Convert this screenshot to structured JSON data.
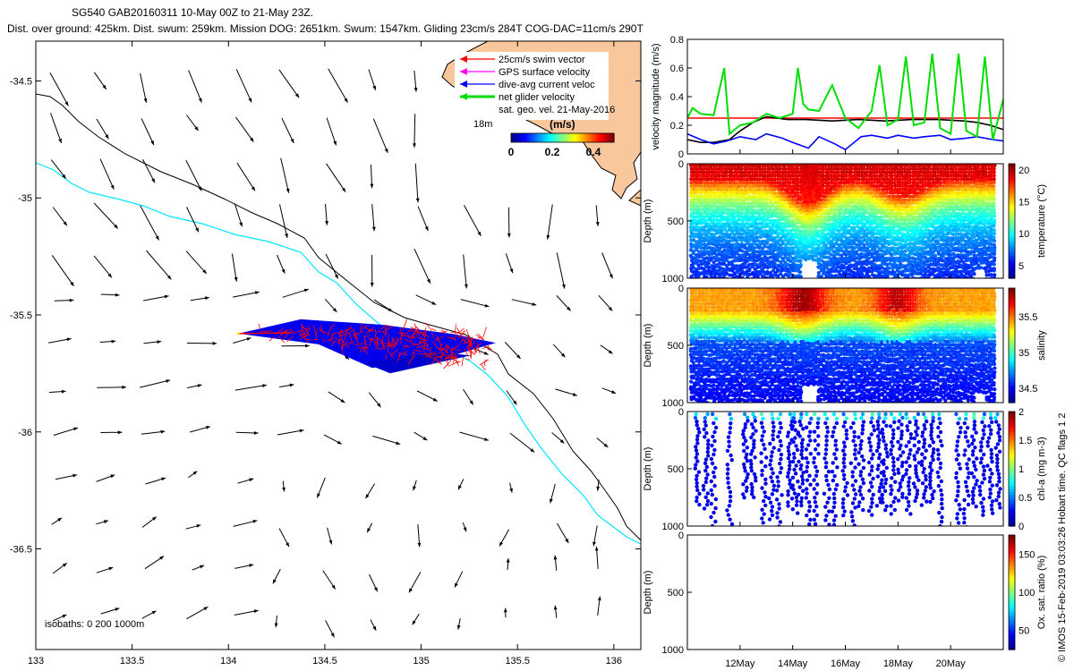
{
  "title_line1": "SG540 GAB20160311 10-May 00Z to 21-May 23Z.",
  "title_line2": "Dist. over ground: 425km. Dist. swum: 259km. Mission DOG: 2651km. Swum: 1547km. Gliding 23cm/s 284T COG-DAC=11cm/s 290T",
  "credit": "© IMOS 15-Feb-2019 03:03:26 Hobart time. QC flags 1  2",
  "chart_data": [
    {
      "id": "map",
      "type": "vector-map",
      "x_ticks": [
        "133",
        "133.5",
        "134",
        "134.5",
        "135",
        "135.5",
        "136"
      ],
      "y_ticks": [
        "-34.5",
        "-35",
        "-35.5",
        "-36",
        "-36.5"
      ],
      "xlim": [
        133.0,
        136.14
      ],
      "ylim": [
        -36.93,
        -34.33
      ],
      "grid": false,
      "legend_position": "top-right",
      "legend": [
        {
          "label": "25cm/s swim vector",
          "color": "#ff0000"
        },
        {
          "label": "GPS surface velocity",
          "color": "#ff00ff"
        },
        {
          "label": "dive-avg current veloc",
          "color": "#0000ff"
        },
        {
          "label": "net glider velocity",
          "color": "#00dd00"
        },
        {
          "label": "sat. geo. vel. 21-May-2016",
          "color": "#000000"
        }
      ],
      "colorbar": {
        "label": "(m/s)",
        "ticks": [
          "0",
          "0.2",
          "0.4"
        ],
        "range": [
          0,
          0.5
        ]
      },
      "land_label": "18m",
      "isobath_label": "isobaths: 0   200  1000m",
      "track_start": [
        134.05,
        -35.58
      ],
      "track_end": [
        135.35,
        -35.65
      ]
    },
    {
      "id": "velocity",
      "type": "line",
      "ylabel": "velocity magnitude (m/s)",
      "ylim": [
        0,
        0.8
      ],
      "y_ticks": [
        "0",
        "0.2",
        "0.4",
        "0.6",
        "0.8"
      ],
      "xlim": [
        10.0,
        22.0
      ],
      "series": [
        {
          "color": "#ff0000",
          "x": [
            10.0,
            22.0
          ],
          "y": [
            0.25,
            0.25
          ]
        },
        {
          "color": "#000000",
          "x": [
            10.0,
            10.5,
            11.0,
            11.6,
            12.0,
            12.5,
            13.0,
            13.8,
            14.5,
            15.5,
            16.5,
            17.5,
            18.5,
            19.5,
            20.5,
            21.0,
            21.5,
            22.0
          ],
          "y": [
            0.1,
            0.08,
            0.08,
            0.1,
            0.16,
            0.22,
            0.26,
            0.24,
            0.24,
            0.23,
            0.24,
            0.23,
            0.24,
            0.24,
            0.23,
            0.22,
            0.2,
            0.17
          ]
        },
        {
          "color": "#0000ff",
          "x": [
            10.0,
            10.5,
            11.0,
            11.5,
            12.0,
            12.6,
            13.0,
            13.6,
            14.0,
            14.6,
            15.0,
            15.6,
            16.0,
            16.6,
            17.0,
            17.6,
            18.0,
            18.6,
            19.0,
            19.6,
            20.0,
            20.6,
            21.0,
            21.6,
            22.0
          ],
          "y": [
            0.14,
            0.1,
            0.07,
            0.09,
            0.12,
            0.1,
            0.14,
            0.11,
            0.08,
            0.04,
            0.12,
            0.07,
            0.03,
            0.12,
            0.13,
            0.11,
            0.13,
            0.11,
            0.12,
            0.13,
            0.1,
            0.11,
            0.12,
            0.1,
            0.09
          ]
        },
        {
          "color": "#00dd00",
          "x": [
            10.0,
            10.2,
            10.5,
            11.0,
            11.4,
            11.6,
            12.0,
            12.5,
            13.0,
            13.5,
            14.0,
            14.2,
            14.4,
            14.6,
            15.0,
            15.5,
            16.0,
            16.5,
            17.0,
            17.3,
            17.6,
            18.0,
            18.3,
            18.6,
            19.0,
            19.3,
            19.6,
            20.0,
            20.3,
            20.6,
            21.0,
            21.3,
            21.6,
            22.0
          ],
          "y": [
            0.25,
            0.32,
            0.28,
            0.27,
            0.6,
            0.14,
            0.2,
            0.22,
            0.28,
            0.25,
            0.28,
            0.6,
            0.35,
            0.31,
            0.3,
            0.48,
            0.25,
            0.18,
            0.3,
            0.62,
            0.2,
            0.24,
            0.68,
            0.2,
            0.22,
            0.7,
            0.18,
            0.14,
            0.7,
            0.16,
            0.12,
            0.68,
            0.1,
            0.38
          ]
        }
      ]
    },
    {
      "id": "temperature",
      "type": "heatmap",
      "ylabel": "Depth (m)",
      "y_ticks": [
        "0",
        "500",
        "1000"
      ],
      "ylim": [
        1000,
        0
      ],
      "xlim": [
        10.0,
        22.0
      ],
      "colorbar": {
        "label": "temperature (°C)",
        "ticks": [
          "5",
          "10",
          "15",
          "20"
        ],
        "range": [
          3,
          21
        ]
      }
    },
    {
      "id": "salinity",
      "type": "heatmap",
      "ylabel": "Depth (m)",
      "y_ticks": [
        "0",
        "500",
        "1000"
      ],
      "ylim": [
        1000,
        0
      ],
      "xlim": [
        10.0,
        22.0
      ],
      "colorbar": {
        "label": "salinity",
        "ticks": [
          "34.5",
          "35",
          "35.5"
        ],
        "range": [
          34.3,
          35.9
        ]
      }
    },
    {
      "id": "chla",
      "type": "heatmap",
      "ylabel": "Depth (m)",
      "y_ticks": [
        "0",
        "500",
        "1000"
      ],
      "ylim": [
        1000,
        0
      ],
      "xlim": [
        10.0,
        22.0
      ],
      "colorbar": {
        "label": "chl-a (mg m-3)",
        "ticks": [
          "0",
          "0.5",
          "1",
          "1.5",
          "2"
        ],
        "range": [
          0,
          2
        ]
      }
    },
    {
      "id": "oxygen",
      "type": "heatmap",
      "ylabel": "Depth (m)",
      "y_ticks": [
        "0",
        "500",
        "1000"
      ],
      "ylim": [
        1000,
        0
      ],
      "xlim": [
        10.0,
        22.0
      ],
      "x_ticks": [
        {
          "label": "12May",
          "x": 12.0
        },
        {
          "label": "14May",
          "x": 14.0
        },
        {
          "label": "16May",
          "x": 16.0
        },
        {
          "label": "18May",
          "x": 18.0
        },
        {
          "label": "20May",
          "x": 20.0
        }
      ],
      "colorbar": {
        "label": "Ox. sat. ratio (%)",
        "ticks": [
          "50",
          "100",
          "150"
        ],
        "range": [
          25,
          175
        ]
      }
    }
  ]
}
